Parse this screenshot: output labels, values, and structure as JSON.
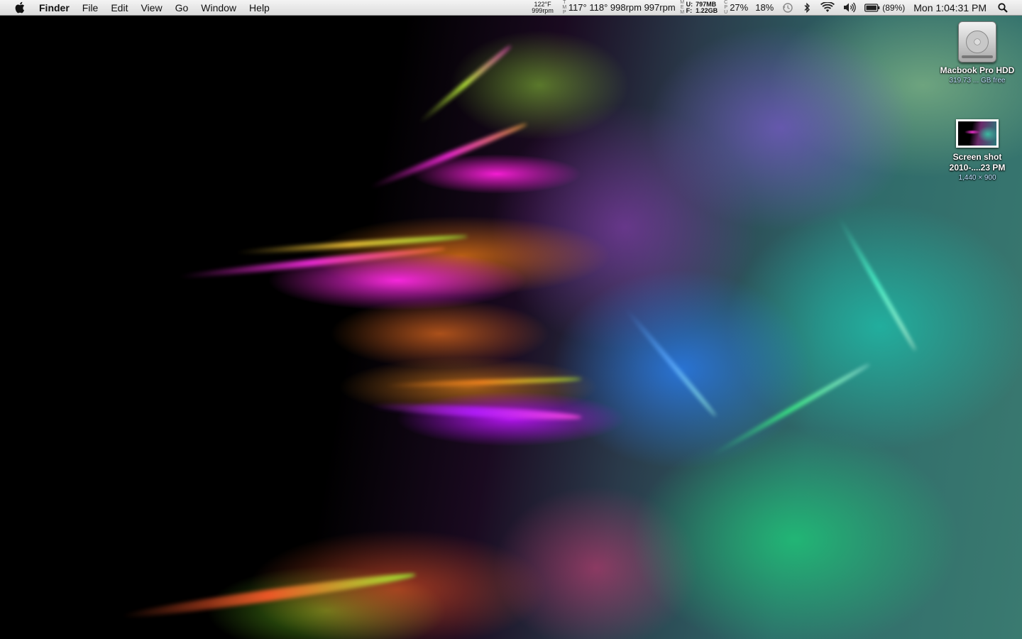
{
  "menubar": {
    "app_name": "Finder",
    "menus": [
      "File",
      "Edit",
      "View",
      "Go",
      "Window",
      "Help"
    ]
  },
  "status": {
    "temp_small_top": "122°F",
    "temp_small_bottom": "999rpm",
    "tmp_label": [
      "T",
      "M",
      "P"
    ],
    "temps_fans": "117° 118° 998rpm 997rpm",
    "mem_label": [
      "M",
      "E",
      "M"
    ],
    "mem_used_label": "U:",
    "mem_free_label": "F:",
    "mem_used": "797MB",
    "mem_free": "1.22GB",
    "cpu_label": [
      "C",
      "P",
      "U"
    ],
    "cpu1": "27%",
    "cpu2": "18%",
    "battery_pct": "(89%)",
    "clock": "Mon 1:04:31 PM"
  },
  "desktop": {
    "hdd": {
      "name": "Macbook Pro HDD",
      "info": "319.73 ... GB free"
    },
    "screenshot": {
      "name": "Screen shot 2010-....23 PM",
      "info": "1,440 × 900"
    }
  }
}
